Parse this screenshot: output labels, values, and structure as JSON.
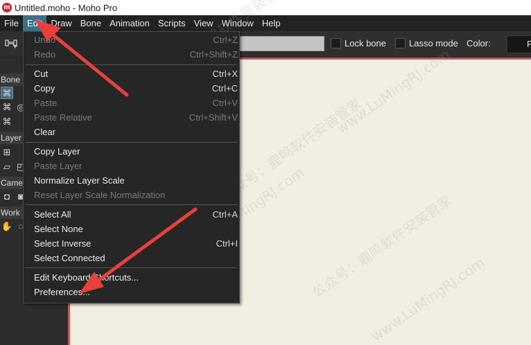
{
  "window": {
    "title": "Untitled.moho - Moho Pro",
    "app_icon": "moho-logo",
    "app_icon_text": "m"
  },
  "menubar": [
    "File",
    "Edit",
    "Draw",
    "Bone",
    "Animation",
    "Scripts",
    "View",
    "Window",
    "Help"
  ],
  "active_menu": "Edit",
  "toolbar": {
    "lock_bone_label": "Lock bone",
    "lasso_mode_label": "Lasso mode",
    "color_label": "Color:",
    "color_value": "P"
  },
  "left_panel": {
    "sections": [
      "Bone",
      "Layer",
      "Came",
      "Work"
    ]
  },
  "edit_menu": [
    {
      "label": "Undo",
      "shortcut": "Ctrl+Z",
      "enabled": false
    },
    {
      "label": "Redo",
      "shortcut": "Ctrl+Shift+Z",
      "enabled": false
    },
    {
      "label": "Cut",
      "shortcut": "Ctrl+X",
      "enabled": true
    },
    {
      "label": "Copy",
      "shortcut": "Ctrl+C",
      "enabled": true
    },
    {
      "label": "Paste",
      "shortcut": "Ctrl+V",
      "enabled": false
    },
    {
      "label": "Paste Relative",
      "shortcut": "Ctrl+Shift+V",
      "enabled": false
    },
    {
      "label": "Clear",
      "shortcut": "",
      "enabled": true
    },
    {
      "label": "Copy Layer",
      "shortcut": "",
      "enabled": true
    },
    {
      "label": "Paste Layer",
      "shortcut": "",
      "enabled": false
    },
    {
      "label": "Normalize Layer Scale",
      "shortcut": "",
      "enabled": true
    },
    {
      "label": "Reset Layer Scale Normalization",
      "shortcut": "",
      "enabled": false
    },
    {
      "label": "Select All",
      "shortcut": "Ctrl+A",
      "enabled": true
    },
    {
      "label": "Select None",
      "shortcut": "",
      "enabled": true
    },
    {
      "label": "Select Inverse",
      "shortcut": "Ctrl+I",
      "enabled": true
    },
    {
      "label": "Select Connected",
      "shortcut": "",
      "enabled": true
    },
    {
      "label": "Edit Keyboard Shortcuts...",
      "shortcut": "",
      "enabled": true
    },
    {
      "label": "Preferences...",
      "shortcut": "",
      "enabled": true
    }
  ],
  "watermark": [
    "公众号：鹿鸣软件安装管家",
    "www.LuMingRJ.com"
  ],
  "colors": {
    "accent": "#3d6f8a",
    "arrow": "#e8403b",
    "canvas": "#f1efe2",
    "canvas_border": "#c0595c"
  }
}
